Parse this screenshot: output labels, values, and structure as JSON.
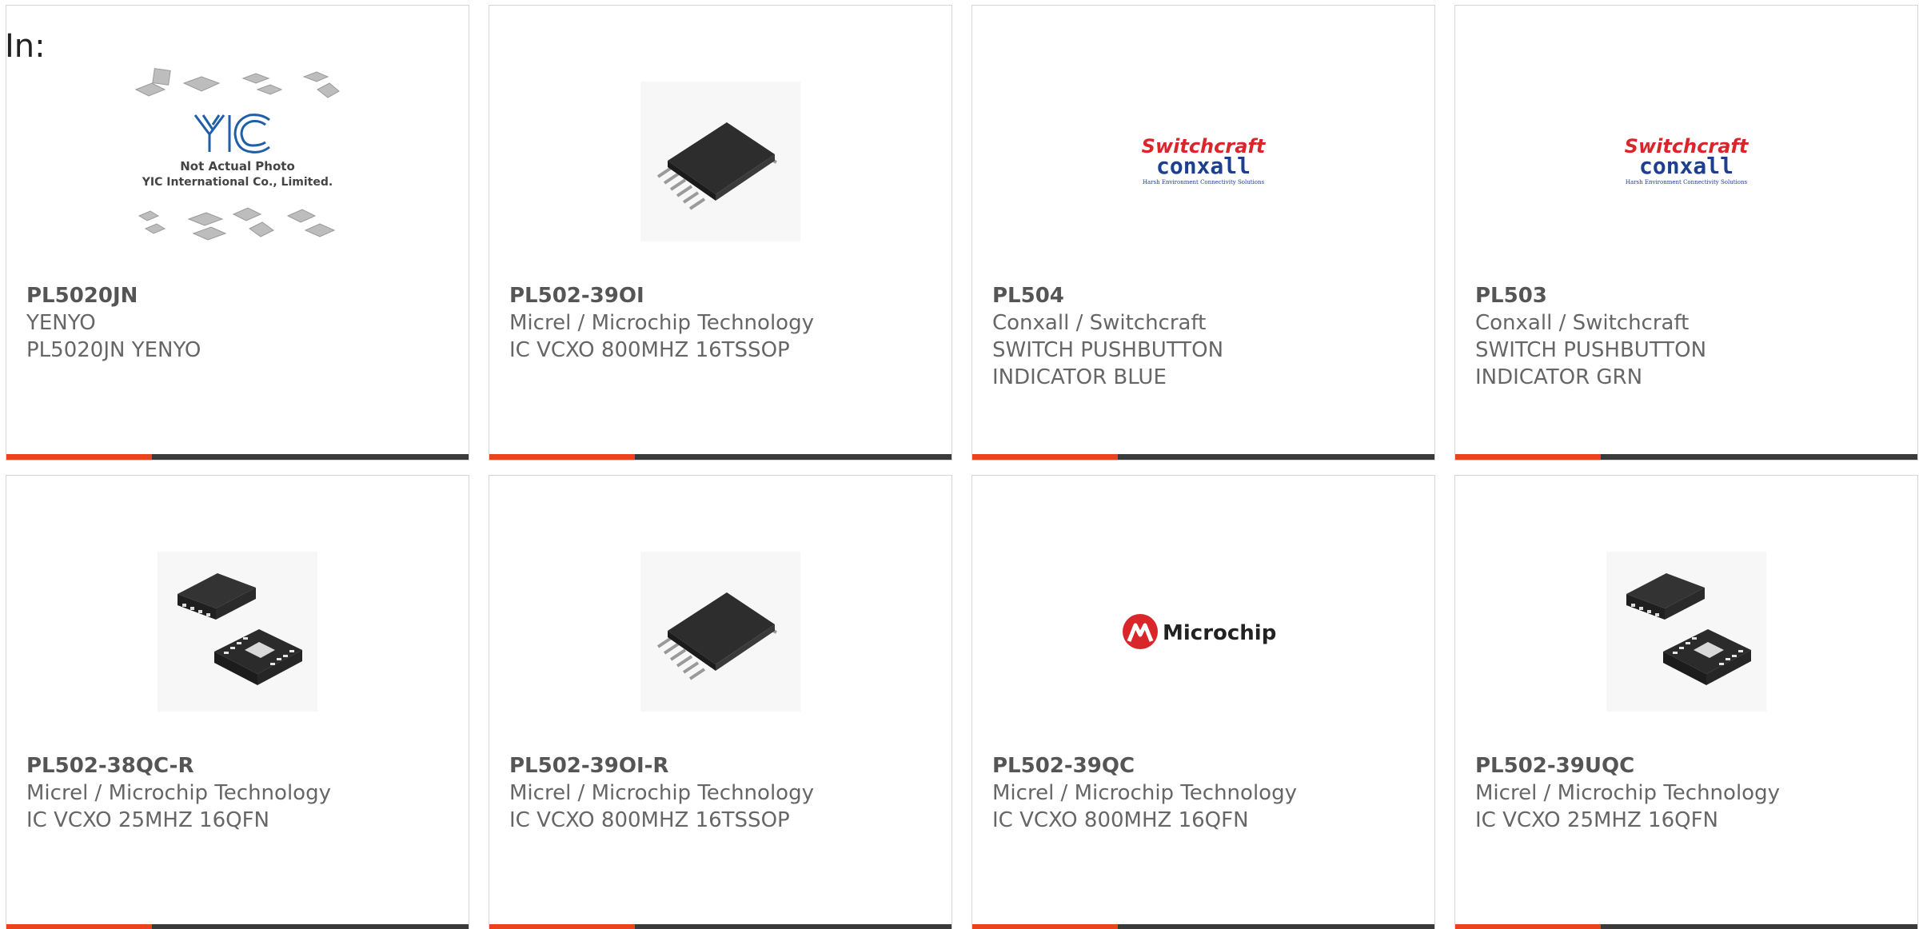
{
  "page": {
    "in_label": "In:"
  },
  "colors": {
    "accent": "#e8431a",
    "bar": "#3a3a3a",
    "text": "#666666",
    "border": "#d6d6d6"
  },
  "products": [
    {
      "part": "PL5020JN",
      "maker": "YENYO",
      "desc1": "PL5020JN YENYO",
      "desc2": "",
      "image": "not-actual-photo-placeholder"
    },
    {
      "part": "PL502-39OI",
      "maker": "Micrel / Microchip Technology",
      "desc1": "IC VCXO 800MHZ 16TSSOP",
      "desc2": "",
      "image": "tssop-chip"
    },
    {
      "part": "PL504",
      "maker": "Conxall / Switchcraft",
      "desc1": "SWITCH PUSHBUTTON",
      "desc2": "INDICATOR BLUE",
      "image": "switchcraft-conxall-logo"
    },
    {
      "part": "PL503",
      "maker": "Conxall / Switchcraft",
      "desc1": "SWITCH PUSHBUTTON",
      "desc2": "INDICATOR GRN",
      "image": "switchcraft-conxall-logo"
    },
    {
      "part": "PL502-38QC-R",
      "maker": "Micrel / Microchip Technology",
      "desc1": "IC VCXO 25MHZ 16QFN",
      "desc2": "",
      "image": "qfn-chip"
    },
    {
      "part": "PL502-39OI-R",
      "maker": "Micrel / Microchip Technology",
      "desc1": "IC VCXO 800MHZ 16TSSOP",
      "desc2": "",
      "image": "tssop-chip"
    },
    {
      "part": "PL502-39QC",
      "maker": "Micrel / Microchip Technology",
      "desc1": "IC VCXO 800MHZ 16QFN",
      "desc2": "",
      "image": "microchip-logo"
    },
    {
      "part": "PL502-39UQC",
      "maker": "Micrel / Microchip Technology",
      "desc1": "IC VCXO 25MHZ 16QFN",
      "desc2": "",
      "image": "qfn-chip"
    }
  ],
  "placeholder_image": {
    "brand": "YIC",
    "line1": "Not Actual Photo",
    "line2": "YIC International Co., Limited."
  },
  "logos": {
    "switchcraft": "Switchcraft",
    "conxall": "conxall",
    "conxall_tag": "Harsh Environment Connectivity Solutions",
    "microchip": "Microchip"
  }
}
